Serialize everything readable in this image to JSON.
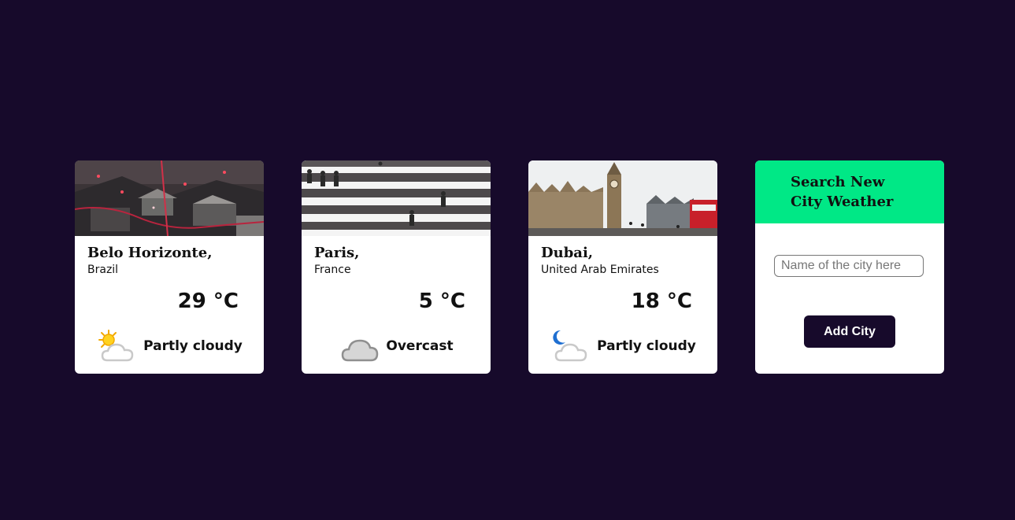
{
  "cities": [
    {
      "name": "Belo Horizonte,",
      "country": "Brazil",
      "temperature": "29 °C",
      "condition": "Partly cloudy",
      "icon": "partly-cloudy-day-icon",
      "photo": "aerial-city-night-photo"
    },
    {
      "name": "Paris,",
      "country": "France",
      "temperature": "5 °C",
      "condition": "Overcast",
      "icon": "overcast-cloud-icon",
      "photo": "crosswalk-pedestrians-photo"
    },
    {
      "name": "Dubai,",
      "country": "United Arab Emirates",
      "temperature": "18 °C",
      "condition": "Partly cloudy",
      "icon": "partly-cloudy-night-icon",
      "photo": "big-ben-westminster-photo"
    }
  ],
  "search": {
    "title": "Search New City Weather",
    "placeholder": "Name of the city here",
    "value": "",
    "button_label": "Add City"
  },
  "colors": {
    "background": "#170a2b",
    "accent": "#00e886",
    "card": "#ffffff",
    "button": "#170a2b"
  }
}
